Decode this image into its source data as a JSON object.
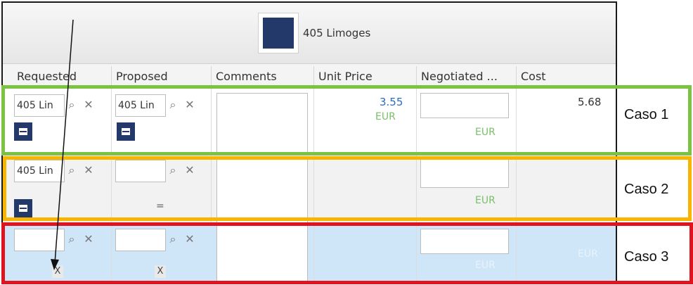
{
  "product": {
    "title": "405 Limoges",
    "swatch_color": "#22396a"
  },
  "columns": [
    {
      "label": "Requested"
    },
    {
      "label": "Proposed"
    },
    {
      "label": "Comments"
    },
    {
      "label": "Unit Price"
    },
    {
      "label": "Negotiated ..."
    },
    {
      "label": "Cost"
    }
  ],
  "rows": [
    {
      "requested_value": "405 Lin",
      "proposed_value": "405 Lin",
      "unit_price": "3.55",
      "unit_price_currency": "EUR",
      "negotiated_currency": "EUR",
      "cost": "5.68"
    },
    {
      "requested_value": "405 Lin",
      "proposed_value": "",
      "proposed_marker": "=",
      "negotiated_currency": "EUR"
    },
    {
      "requested_value": "",
      "requested_marker": "X",
      "proposed_value": "",
      "proposed_marker": "X",
      "negotiated_currency": "EUR",
      "cost_currency": "EUR"
    }
  ],
  "icons": {
    "search": "magnifier-icon",
    "clear": "close-icon",
    "color": "color-swatch-icon"
  },
  "annotations": {
    "caso1": "Caso 1",
    "caso2": "Caso 2",
    "caso3": "Caso 3",
    "caso1_color": "#7dc242",
    "caso2_color": "#f7b500",
    "caso3_color": "#e0141e"
  }
}
